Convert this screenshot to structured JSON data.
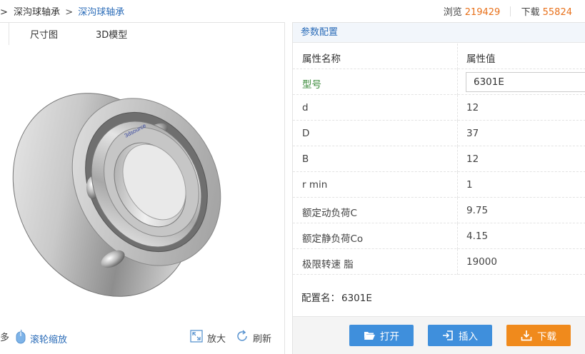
{
  "breadcrumb": {
    "prefix": ">",
    "parent": "深沟球轴承",
    "separator": ">",
    "current": "深沟球轴承"
  },
  "stats": {
    "views_label": "浏览",
    "views_value": "219429",
    "downloads_label": "下载",
    "downloads_value": "55824"
  },
  "viewer": {
    "tabs": [
      "尺寸图",
      "3D模型"
    ],
    "part_label": "3dsource",
    "footer": {
      "partial_left": "多",
      "scroll_zoom": "滚轮缩放",
      "zoom": "放大",
      "refresh": "刷新"
    }
  },
  "params": {
    "title": "参数配置",
    "header_name": "属性名称",
    "header_value": "属性值",
    "model_label": "型号",
    "model_value": "6301E",
    "rows": [
      {
        "name": "d",
        "value": "12"
      },
      {
        "name": "D",
        "value": "37"
      },
      {
        "name": "B",
        "value": "12"
      },
      {
        "name": "r min",
        "value": "1"
      },
      {
        "name": "额定动负荷C",
        "value": "9.75"
      },
      {
        "name": "额定静负荷Co",
        "value": "4.15"
      },
      {
        "name": "极限转速 脂",
        "value": "19000"
      }
    ],
    "config_label": "配置名：",
    "config_value": "6301E"
  },
  "actions": {
    "open": "打开",
    "insert": "插入",
    "download": "下载"
  },
  "colors": {
    "accent_blue": "#3f8fdc",
    "accent_orange": "#f08a1c",
    "link_blue": "#2b6cb8",
    "number_orange": "#e8711b"
  }
}
